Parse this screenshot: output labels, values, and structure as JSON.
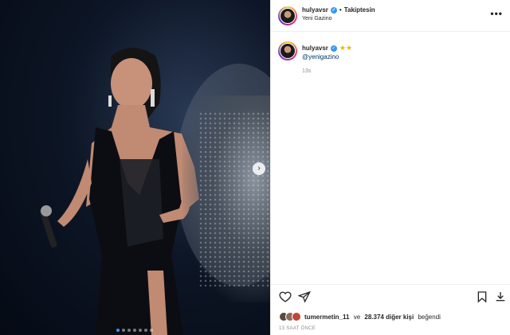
{
  "post": {
    "username": "hulyavsr",
    "follow_status": "Takiptesin",
    "separator": "•",
    "location": "Yeni Gazino",
    "more_icon": "more-horizontal-icon"
  },
  "comment": {
    "username": "hulyavsr",
    "emoji": "★★",
    "mention": "@yenigazino",
    "time": "13s"
  },
  "likes": {
    "user": "tumermetin_11",
    "connector": "ve",
    "others": "28.374 diğer kişi",
    "suffix": "beğendi"
  },
  "timestamp": "13 SAAT ÖNCE",
  "carousel": {
    "count": 7,
    "active": 0
  },
  "colors": {
    "verified": "#3897f0",
    "link": "#00376b",
    "muted": "#8e8e8e"
  }
}
